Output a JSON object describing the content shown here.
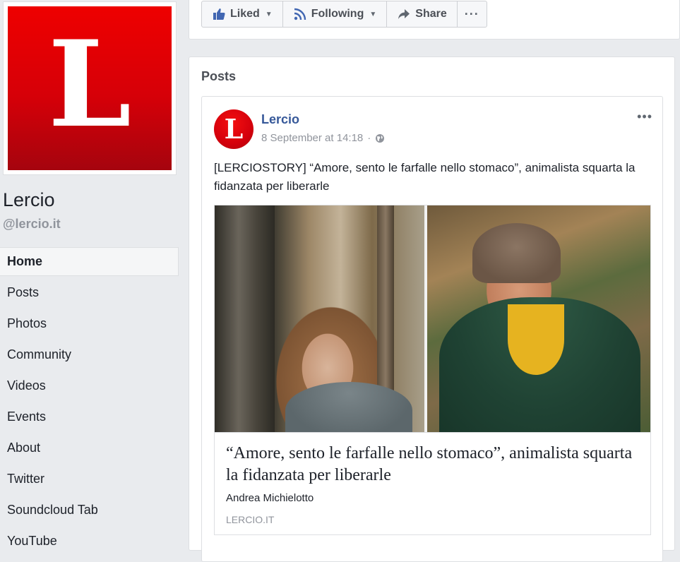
{
  "page": {
    "name": "Lercio",
    "handle": "@lercio.it",
    "logo_letter": "L"
  },
  "nav": {
    "items": [
      {
        "label": "Home",
        "active": true
      },
      {
        "label": "Posts"
      },
      {
        "label": "Photos"
      },
      {
        "label": "Community"
      },
      {
        "label": "Videos"
      },
      {
        "label": "Events"
      },
      {
        "label": "About"
      },
      {
        "label": "Twitter"
      },
      {
        "label": "Soundcloud Tab"
      },
      {
        "label": "YouTube"
      }
    ]
  },
  "actions": {
    "liked": "Liked",
    "following": "Following",
    "share": "Share",
    "more": "···"
  },
  "posts": {
    "title": "Posts",
    "post": {
      "author": "Lercio",
      "timestamp": "8 September at 14:18",
      "separator": "·",
      "menu": "•••",
      "text": "[LERCIOSTORY] “Amore, sento le farfalle nello stomaco”, animalista squarta la fidanzata per liberarle",
      "link": {
        "title": "“Amore, sento le farfalle nello stomaco”, animalista squarta la fidanzata per liberarle",
        "author": "Andrea Michielotto",
        "domain": "LERCIO.IT"
      }
    }
  },
  "colors": {
    "brand_red": "#e00000",
    "link_blue": "#365899",
    "background": "#e9ebee"
  }
}
